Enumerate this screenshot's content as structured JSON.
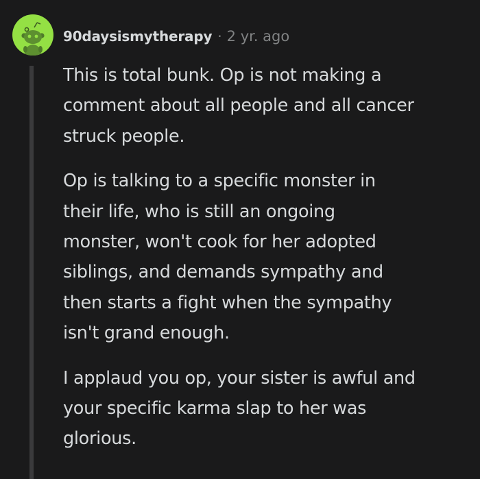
{
  "comment": {
    "username": "90daysismytherapy",
    "separator": "·",
    "timestamp": "2 yr. ago",
    "avatar_icon": "reddit-snoo-avatar-icon",
    "avatar_color": "#94e044",
    "paragraphs": [
      [
        "This is total bunk. Op is not making a",
        "comment about all people and all cancer",
        "struck people."
      ],
      [
        "Op is talking to a specific monster in",
        "their life, who is still an ongoing",
        "monster, won't cook for her adopted",
        "siblings, and demands sympathy and",
        "then starts a fight when the sympathy",
        "isn't grand enough."
      ],
      [
        "I applaud you op, your sister is awful and",
        "your specific karma slap to her was",
        "glorious."
      ]
    ]
  },
  "colors": {
    "background": "#1a1a1b",
    "text": "#d7dadc",
    "muted_text": "#818384",
    "thread_line": "#3a3a3c"
  }
}
